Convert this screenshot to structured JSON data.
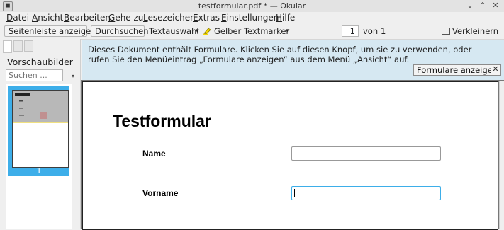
{
  "window": {
    "title": "testformular.pdf * — Okular"
  },
  "menubar": {
    "items": [
      {
        "label": "Datei",
        "mnemonic": "D",
        "rest": "atei"
      },
      {
        "label": "Ansicht",
        "mnemonic": "A",
        "rest": "nsicht"
      },
      {
        "label": "Bearbeiten",
        "mnemonic": "B",
        "rest": "earbeiten"
      },
      {
        "label": "Gehe zu",
        "mnemonic": "G",
        "rest": "ehe zu"
      },
      {
        "label": "Lesezeichen",
        "mnemonic": "L",
        "rest": "esezeichen"
      },
      {
        "label": "Extras",
        "mnemonic": "E",
        "rest": "xtras"
      },
      {
        "label": "Einstellungen",
        "mnemonic": "E",
        "rest": "instellungen"
      },
      {
        "label": "Hilfe",
        "mnemonic": "H",
        "rest": "ilfe"
      }
    ]
  },
  "toolbar": {
    "sidebar_toggle": "Seitenleiste anzeigen",
    "browse": "Durchsuchen",
    "text_select": "Textauswahl",
    "highlighter": "Gelber Textmarker",
    "page_current": "1",
    "page_of": "von",
    "page_total": "1",
    "zoom_out": "Verkleinern"
  },
  "sidebar": {
    "heading": "Vorschaubilder",
    "search_placeholder": "Suchen ...",
    "thumb_page_number": "1"
  },
  "banner": {
    "message": "Dieses Dokument enthält Formulare. Klicken Sie auf diesen Knopf, um sie zu verwenden, oder rufen Sie den Menüeintrag „Formulare anzeigen“ aus dem Menü „Ansicht“ auf.",
    "button": "Formulare anzeigen"
  },
  "document": {
    "title": "Testformular",
    "fields": [
      {
        "label": "Name",
        "value": ""
      },
      {
        "label": "Vorname",
        "value": ""
      }
    ]
  },
  "colors": {
    "accent": "#3daee9",
    "banner": "#d6e8f2",
    "highlighter": "#f2d600"
  }
}
